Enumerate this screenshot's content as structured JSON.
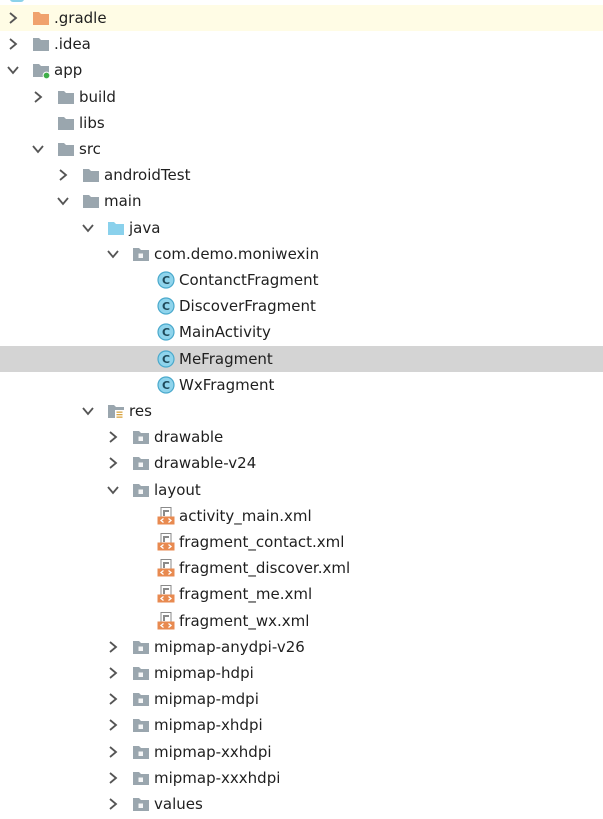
{
  "colors": {
    "folder": "#9aa6ae",
    "folder_orange": "#f0a26d",
    "folder_java": "#8ad1ec",
    "class_circle": "#8fd4ec",
    "class_ring": "#4aa9cc",
    "xml_orange": "#e88a50",
    "highlight_row": "#fffce5",
    "selected_row": "#d4d4d4",
    "text": "#1f1f1f",
    "arrow": "#555555"
  },
  "tree": {
    "items": [
      {
        "label": ".gradle",
        "depth": 0,
        "arrow": "right",
        "icon": "folder-orange",
        "highlight": true
      },
      {
        "label": ".idea",
        "depth": 0,
        "arrow": "right",
        "icon": "folder"
      },
      {
        "label": "app",
        "depth": 0,
        "arrow": "down",
        "icon": "module-folder"
      },
      {
        "label": "build",
        "depth": 1,
        "arrow": "right",
        "icon": "folder"
      },
      {
        "label": "libs",
        "depth": 1,
        "arrow": "none",
        "icon": "folder"
      },
      {
        "label": "src",
        "depth": 1,
        "arrow": "down",
        "icon": "folder"
      },
      {
        "label": "androidTest",
        "depth": 2,
        "arrow": "right",
        "icon": "folder"
      },
      {
        "label": "main",
        "depth": 2,
        "arrow": "down",
        "icon": "folder"
      },
      {
        "label": "java",
        "depth": 3,
        "arrow": "down",
        "icon": "folder-java"
      },
      {
        "label": "com.demo.moniwexin",
        "depth": 4,
        "arrow": "down",
        "icon": "package-folder"
      },
      {
        "label": "ContanctFragment",
        "depth": 5,
        "arrow": "none",
        "icon": "class"
      },
      {
        "label": "DiscoverFragment",
        "depth": 5,
        "arrow": "none",
        "icon": "class"
      },
      {
        "label": "MainActivity",
        "depth": 5,
        "arrow": "none",
        "icon": "class"
      },
      {
        "label": "MeFragment",
        "depth": 5,
        "arrow": "none",
        "icon": "class",
        "selected": true
      },
      {
        "label": "WxFragment",
        "depth": 5,
        "arrow": "none",
        "icon": "class"
      },
      {
        "label": "res",
        "depth": 3,
        "arrow": "down",
        "icon": "res-folder"
      },
      {
        "label": "drawable",
        "depth": 4,
        "arrow": "right",
        "icon": "package-folder"
      },
      {
        "label": "drawable-v24",
        "depth": 4,
        "arrow": "right",
        "icon": "package-folder"
      },
      {
        "label": "layout",
        "depth": 4,
        "arrow": "down",
        "icon": "package-folder"
      },
      {
        "label": "activity_main.xml",
        "depth": 5,
        "arrow": "none",
        "icon": "xml"
      },
      {
        "label": "fragment_contact.xml",
        "depth": 5,
        "arrow": "none",
        "icon": "xml"
      },
      {
        "label": "fragment_discover.xml",
        "depth": 5,
        "arrow": "none",
        "icon": "xml"
      },
      {
        "label": "fragment_me.xml",
        "depth": 5,
        "arrow": "none",
        "icon": "xml"
      },
      {
        "label": "fragment_wx.xml",
        "depth": 5,
        "arrow": "none",
        "icon": "xml"
      },
      {
        "label": "mipmap-anydpi-v26",
        "depth": 4,
        "arrow": "right",
        "icon": "package-folder"
      },
      {
        "label": "mipmap-hdpi",
        "depth": 4,
        "arrow": "right",
        "icon": "package-folder"
      },
      {
        "label": "mipmap-mdpi",
        "depth": 4,
        "arrow": "right",
        "icon": "package-folder"
      },
      {
        "label": "mipmap-xhdpi",
        "depth": 4,
        "arrow": "right",
        "icon": "package-folder"
      },
      {
        "label": "mipmap-xxhdpi",
        "depth": 4,
        "arrow": "right",
        "icon": "package-folder"
      },
      {
        "label": "mipmap-xxxhdpi",
        "depth": 4,
        "arrow": "right",
        "icon": "package-folder"
      },
      {
        "label": "values",
        "depth": 4,
        "arrow": "right",
        "icon": "package-folder"
      }
    ]
  }
}
